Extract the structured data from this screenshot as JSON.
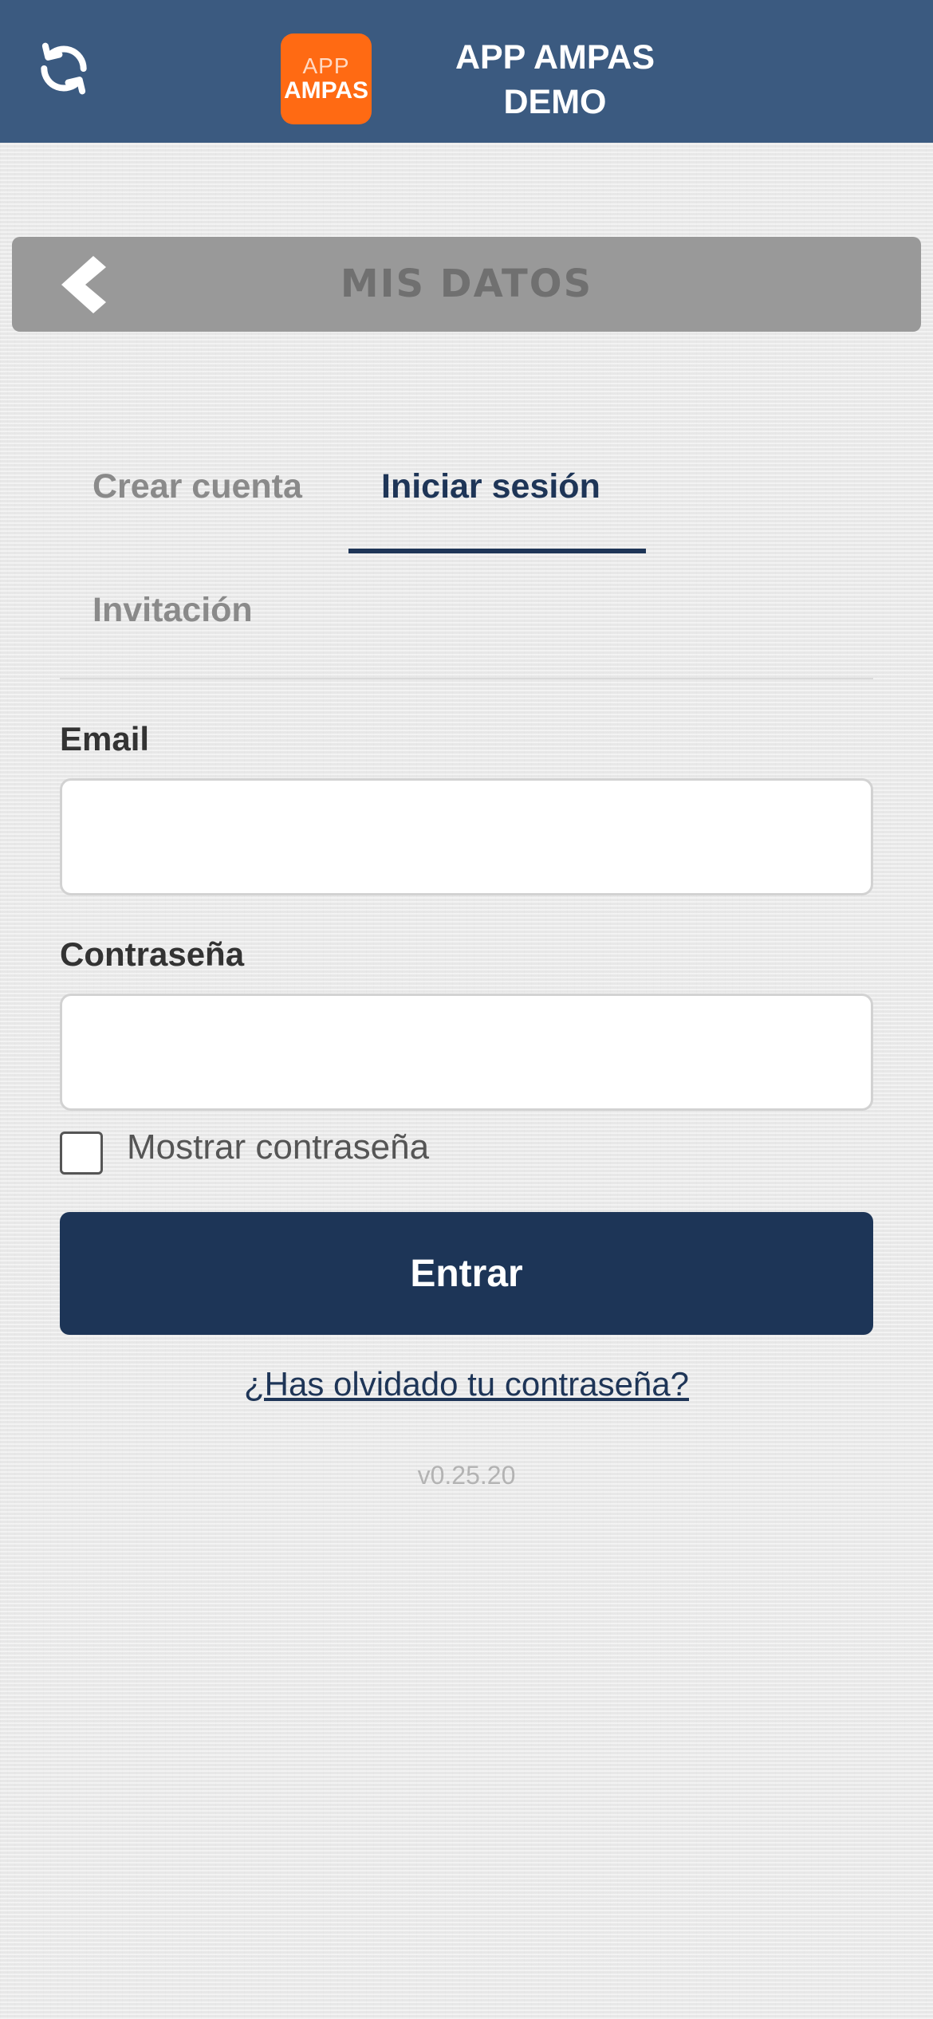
{
  "header": {
    "logo_top": "APP",
    "logo_bottom": "AMPAS",
    "title_line1": "APP AMPAS",
    "title_line2": "DEMO",
    "refresh_icon": "refresh-icon",
    "bg_color": "#3b5a80",
    "logo_color": "#ff6a13"
  },
  "section": {
    "title": "MIS DATOS",
    "back_icon": "chevron-left-icon"
  },
  "tabs": [
    {
      "label": "Crear cuenta",
      "active": false
    },
    {
      "label": "Iniciar sesión",
      "active": true
    },
    {
      "label": "Invitación",
      "active": false
    }
  ],
  "form": {
    "email_label": "Email",
    "email_value": "",
    "password_label": "Contraseña",
    "password_value": "",
    "show_password_label": "Mostrar contraseña",
    "show_password_checked": false,
    "submit_label": "Entrar",
    "forgot_link": "¿Has olvidado tu contraseña?"
  },
  "footer": {
    "version": "v0.25.20"
  },
  "colors": {
    "primary": "#1d3557",
    "section_bar": "#999999"
  }
}
